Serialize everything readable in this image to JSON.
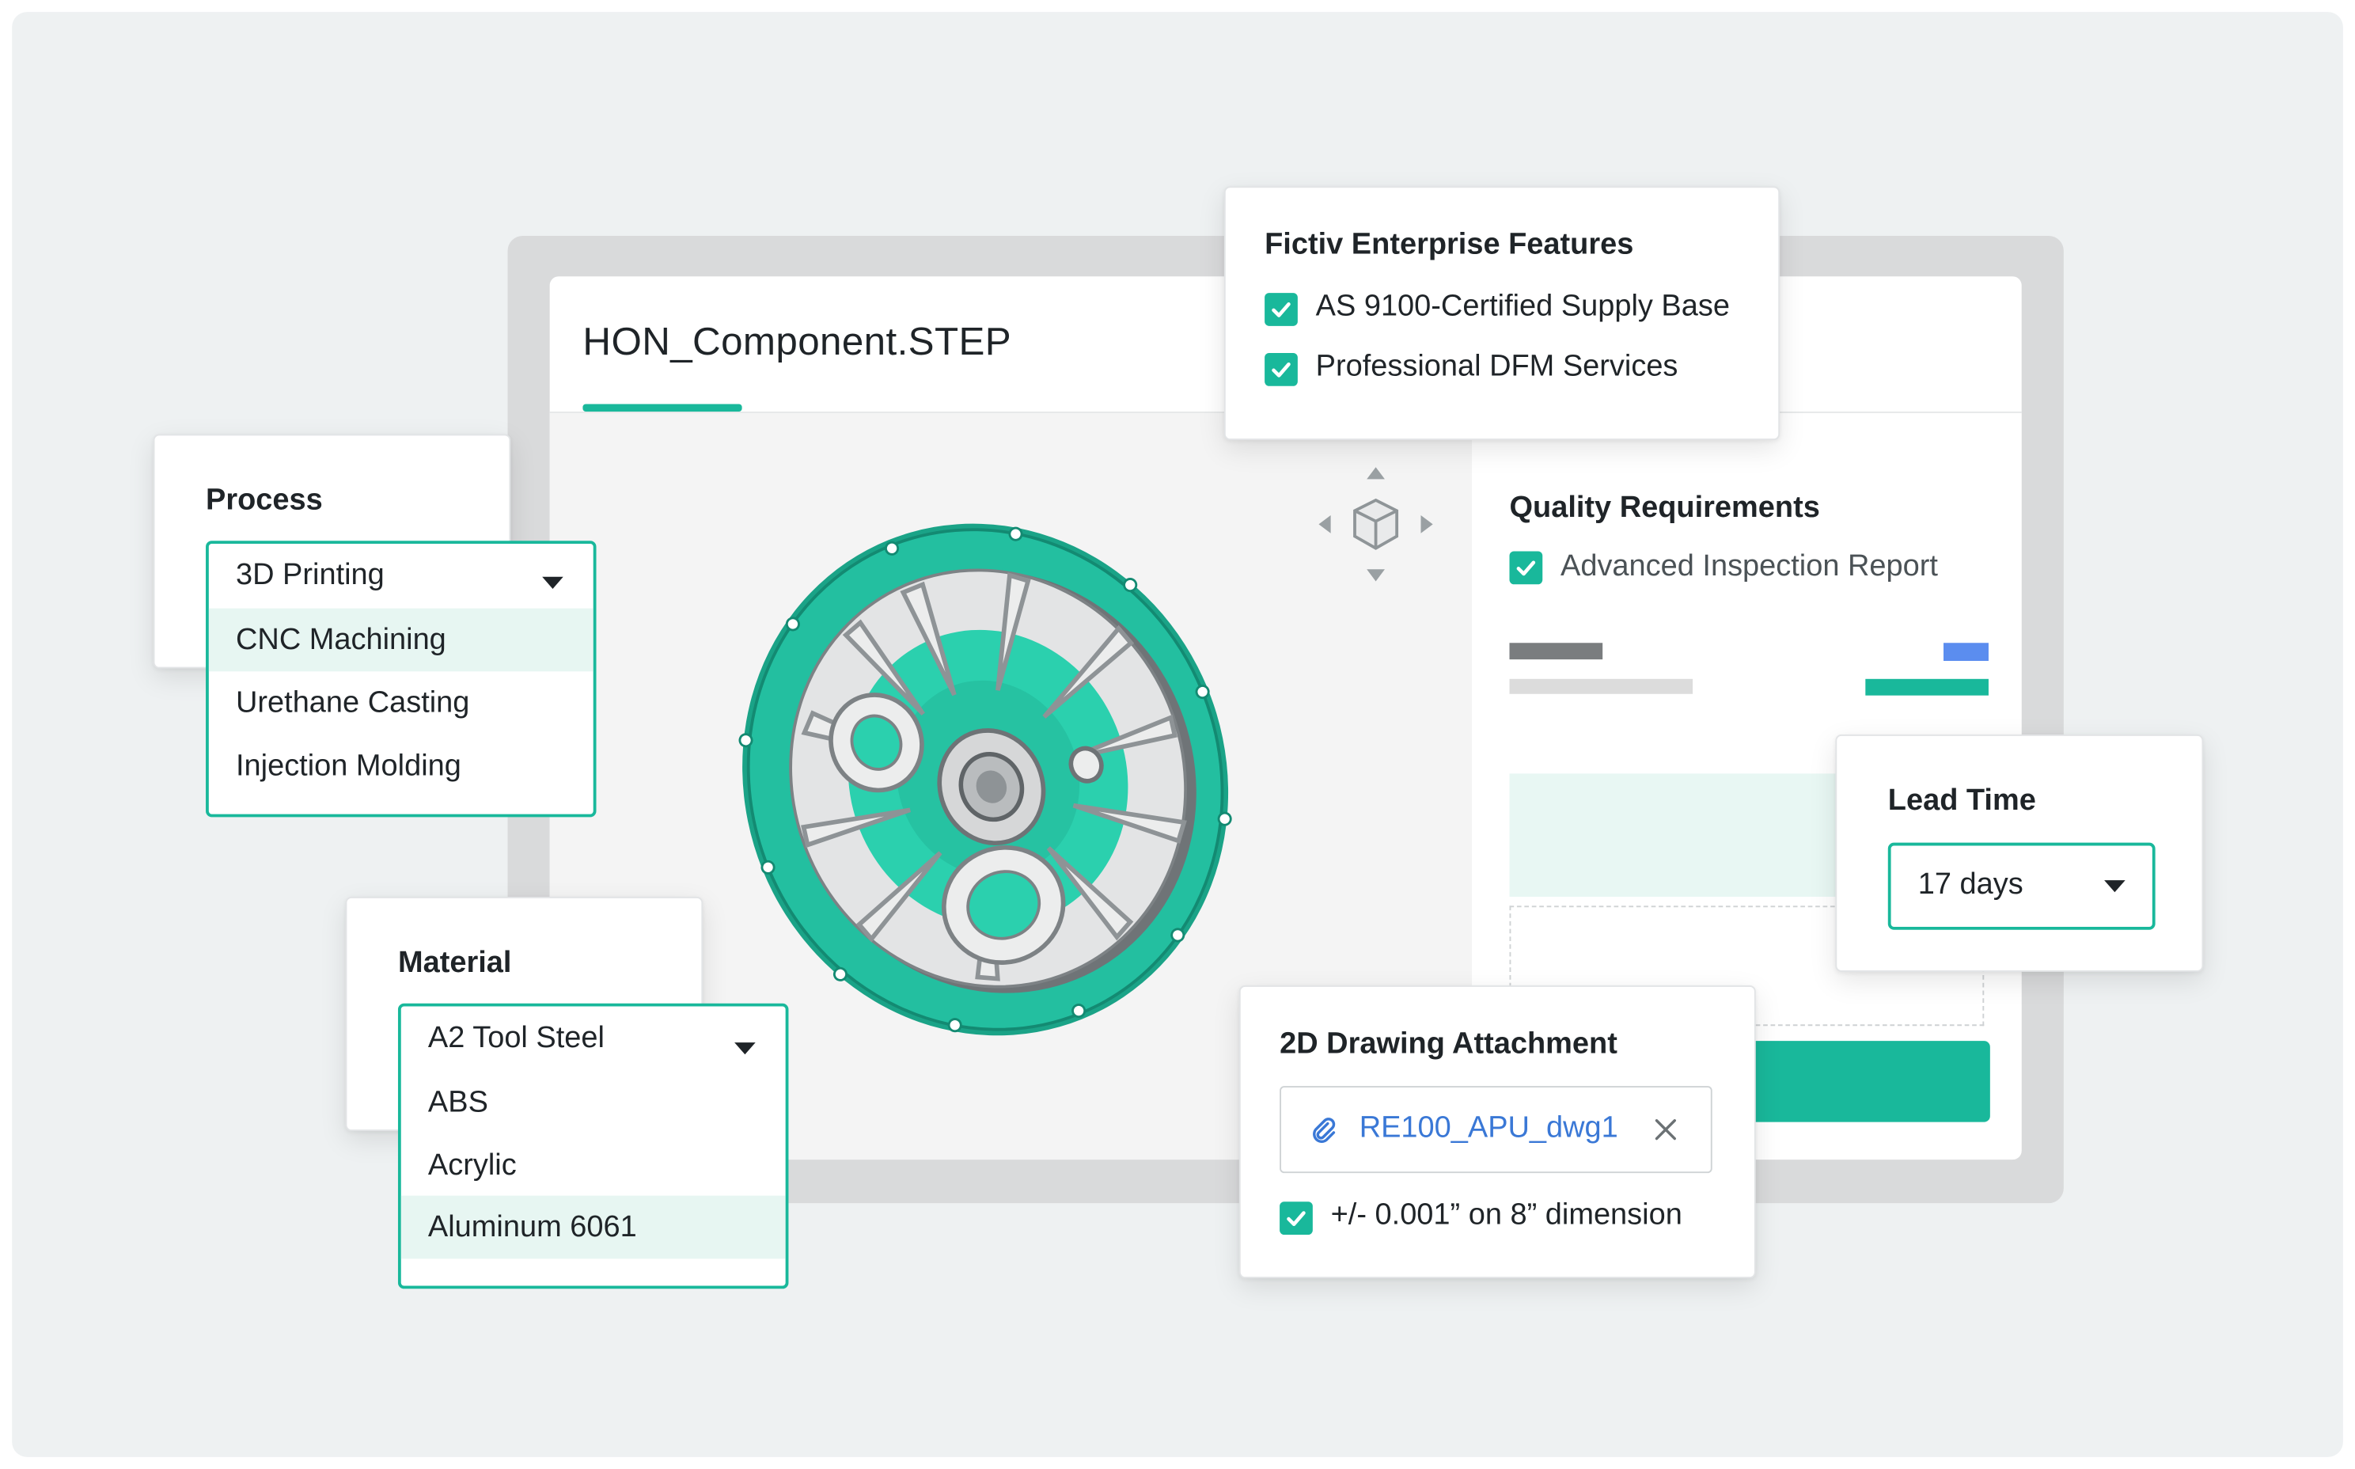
{
  "main": {
    "file_name": "HON_Component.STEP"
  },
  "enterprise": {
    "title": "Fictiv Enterprise Features",
    "items": [
      "AS 9100-Certified Supply Base",
      "Professional DFM Services"
    ]
  },
  "process": {
    "title": "Process",
    "selected": "3D Printing",
    "options": [
      "CNC Machining",
      "Urethane Casting",
      "Injection Molding"
    ],
    "highlighted": "CNC Machining"
  },
  "material": {
    "title": "Material",
    "selected": "A2 Tool Steel",
    "options": [
      "ABS",
      "Acrylic",
      "Aluminum 6061"
    ],
    "highlighted": "Aluminum 6061"
  },
  "quality": {
    "title": "Quality Requirements",
    "item": "Advanced Inspection Report"
  },
  "lead_time": {
    "title": "Lead Time",
    "value": "17 days"
  },
  "drawing": {
    "title": "2D Drawing Attachment",
    "file": "RE100_APU_dwg1",
    "note": "+/- 0.001” on 8” dimension"
  },
  "colors": {
    "accent": "#19b89b",
    "link": "#3a78d6",
    "highlight": "#e7f6f2",
    "blue_bar": "#5b8def"
  },
  "icons": [
    "view-cube-icon",
    "paperclip-icon",
    "close-icon",
    "check-icon",
    "chevron-down-icon"
  ]
}
